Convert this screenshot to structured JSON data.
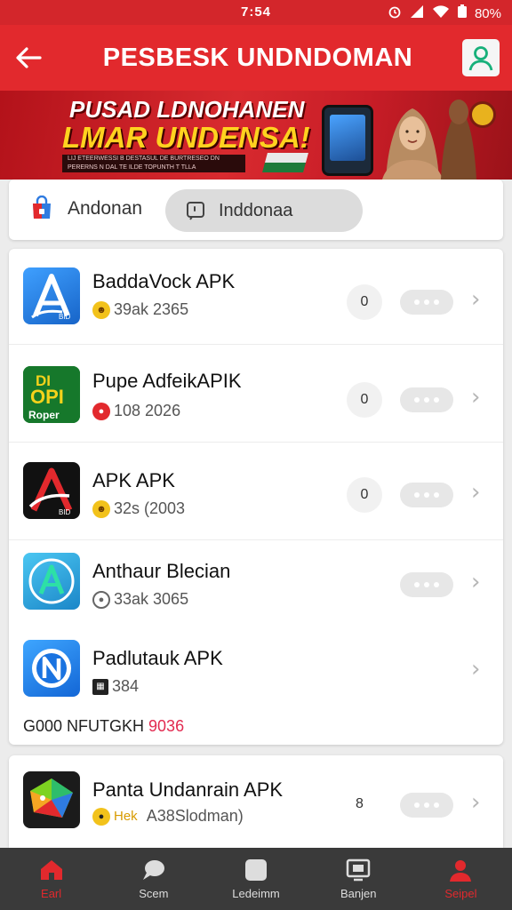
{
  "status_bar": {
    "time": "7:54",
    "battery": "80%"
  },
  "header": {
    "title": "PESBESK UNDNDOMAN"
  },
  "banner": {
    "line1": "PUSAD LDNOHANEN",
    "line2": "LMAR UNDENSA!",
    "fine_print": "LIJ ETEERWESSI B DESTASUL DE BURTRESEO DN PERERNS N DAL TE ILDE TOPUNTH T TLLA"
  },
  "tabs": [
    {
      "label": "Andonan"
    },
    {
      "label": "Inddonaa"
    }
  ],
  "apps": [
    {
      "name": "BaddaVock APK",
      "meta": "39ak 2365",
      "count": "0"
    },
    {
      "name": "Pupe AdfeikAPIK",
      "meta": "108 2026",
      "count": "0"
    },
    {
      "name": "APK APK",
      "meta": "32s (2003",
      "count": "0"
    },
    {
      "name": "Anthaur Blecian",
      "meta": "33ak 3065",
      "count": ""
    },
    {
      "name": "Padlutauk APK",
      "meta": "384",
      "count": ""
    }
  ],
  "section_footer": {
    "prefix": "G000 NFUTGKH ",
    "highlight": "9036"
  },
  "apps_2": [
    {
      "name": "Panta Undanrain APK",
      "meta_prefix": "Hek",
      "meta": "A38Slodman)",
      "count": "8"
    }
  ],
  "icon_labels": {
    "app2_line1": "DI",
    "app2_line2": "OPI",
    "app2_line3": "Roper",
    "app1_badge": "BID",
    "app3_badge": "BID"
  },
  "bottom_nav": [
    {
      "label": "Earl"
    },
    {
      "label": "Scem"
    },
    {
      "label": "Ledeimm"
    },
    {
      "label": "Banjen"
    },
    {
      "label": "Seipel"
    }
  ],
  "colors": {
    "brand_red": "#e2292d",
    "nav_bg": "#3a3a3a",
    "highlight_pink": "#e2294f"
  }
}
